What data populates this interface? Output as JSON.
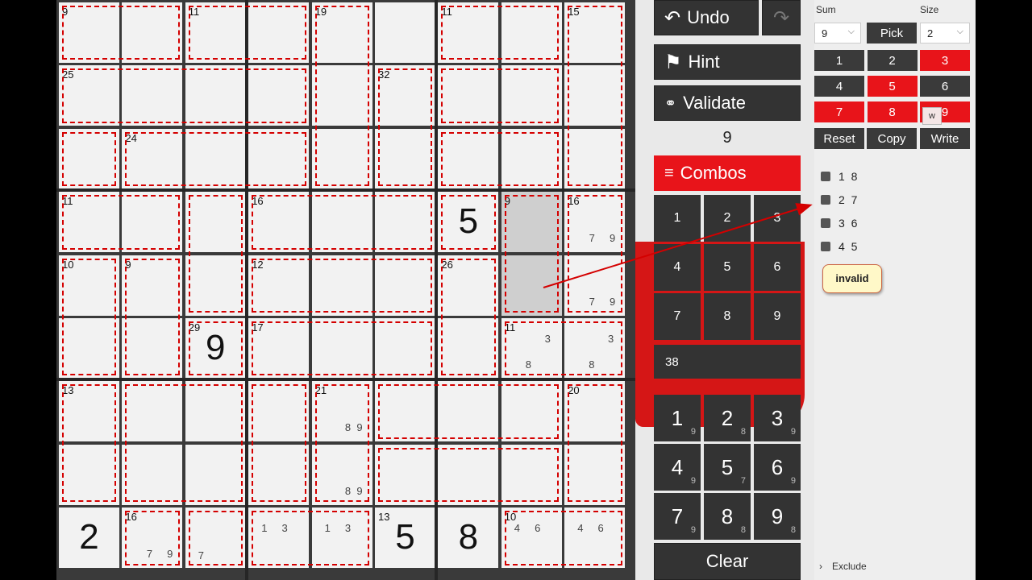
{
  "board": {
    "cages": [
      {
        "r": 0,
        "c": 0,
        "v": "9"
      },
      {
        "r": 0,
        "c": 2,
        "v": "11"
      },
      {
        "r": 0,
        "c": 4,
        "v": "19"
      },
      {
        "r": 0,
        "c": 6,
        "v": "11"
      },
      {
        "r": 0,
        "c": 8,
        "v": "15"
      },
      {
        "r": 1,
        "c": 0,
        "v": "25"
      },
      {
        "r": 1,
        "c": 5,
        "v": "32"
      },
      {
        "r": 2,
        "c": 1,
        "v": "24"
      },
      {
        "r": 3,
        "c": 0,
        "v": "11"
      },
      {
        "r": 3,
        "c": 3,
        "v": "16"
      },
      {
        "r": 3,
        "c": 7,
        "v": "9"
      },
      {
        "r": 3,
        "c": 8,
        "v": "16"
      },
      {
        "r": 4,
        "c": 0,
        "v": "10"
      },
      {
        "r": 4,
        "c": 1,
        "v": "9"
      },
      {
        "r": 4,
        "c": 3,
        "v": "12"
      },
      {
        "r": 4,
        "c": 6,
        "v": "26"
      },
      {
        "r": 5,
        "c": 2,
        "v": "29"
      },
      {
        "r": 5,
        "c": 3,
        "v": "17"
      },
      {
        "r": 5,
        "c": 7,
        "v": "11"
      },
      {
        "r": 6,
        "c": 0,
        "v": "13"
      },
      {
        "r": 6,
        "c": 4,
        "v": "21"
      },
      {
        "r": 6,
        "c": 8,
        "v": "20"
      },
      {
        "r": 8,
        "c": 1,
        "v": "16"
      },
      {
        "r": 8,
        "c": 5,
        "v": "13"
      },
      {
        "r": 8,
        "c": 7,
        "v": "10"
      }
    ],
    "values": [
      {
        "r": 3,
        "c": 6,
        "v": "5"
      },
      {
        "r": 5,
        "c": 2,
        "v": "9"
      },
      {
        "r": 8,
        "c": 0,
        "v": "2"
      },
      {
        "r": 8,
        "c": 5,
        "v": "5"
      },
      {
        "r": 8,
        "c": 6,
        "v": "8"
      }
    ],
    "candidates": [
      {
        "r": 3,
        "c": 8,
        "t": "7     9"
      },
      {
        "r": 4,
        "c": 8,
        "t": "7     9"
      },
      {
        "r": 5,
        "c": 7,
        "t": "3",
        "pos": "tr"
      },
      {
        "r": 5,
        "c": 7,
        "t": "8",
        "pos": "bc"
      },
      {
        "r": 5,
        "c": 8,
        "t": "3",
        "pos": "tr"
      },
      {
        "r": 5,
        "c": 8,
        "t": "8",
        "pos": "bc"
      },
      {
        "r": 6,
        "c": 4,
        "t": "8  9"
      },
      {
        "r": 7,
        "c": 4,
        "t": "8  9"
      },
      {
        "r": 8,
        "c": 1,
        "t": "7     9"
      },
      {
        "r": 8,
        "c": 2,
        "t": "7",
        "pos": "bl"
      },
      {
        "r": 8,
        "c": 3,
        "t": "1     3",
        "pos": "mid"
      },
      {
        "r": 8,
        "c": 4,
        "t": "1     3",
        "pos": "mid"
      },
      {
        "r": 8,
        "c": 7,
        "t": "4     6",
        "pos": "mid"
      },
      {
        "r": 8,
        "c": 8,
        "t": "4     6",
        "pos": "mid"
      }
    ]
  },
  "controls": {
    "undo_label": "Undo",
    "redo_icon": "redo-icon",
    "hint_label": "Hint",
    "validate_label": "Validate",
    "current_sum": "9",
    "combos_label": "Combos",
    "combo_keys": [
      "1",
      "2",
      "3",
      "4",
      "5",
      "6",
      "7",
      "8",
      "9"
    ],
    "combo_total": "38",
    "digits": [
      {
        "d": "1",
        "s": "9"
      },
      {
        "d": "2",
        "s": "8"
      },
      {
        "d": "3",
        "s": "9"
      },
      {
        "d": "4",
        "s": "9"
      },
      {
        "d": "5",
        "s": "7"
      },
      {
        "d": "6",
        "s": "9"
      },
      {
        "d": "7",
        "s": "9"
      },
      {
        "d": "8",
        "s": "8"
      },
      {
        "d": "9",
        "s": "8"
      }
    ],
    "clear_label": "Clear"
  },
  "side": {
    "sum_label": "Sum",
    "size_label": "Size",
    "sum_value": "9",
    "size_value": "2",
    "pick_label": "Pick",
    "numbers": [
      {
        "n": "1",
        "on": false
      },
      {
        "n": "2",
        "on": false
      },
      {
        "n": "3",
        "on": true
      },
      {
        "n": "4",
        "on": false
      },
      {
        "n": "5",
        "on": true
      },
      {
        "n": "6",
        "on": false
      },
      {
        "n": "7",
        "on": true
      },
      {
        "n": "8",
        "on": true
      },
      {
        "n": "9",
        "on": true
      }
    ],
    "tooltip_w": "w",
    "reset_label": "Reset",
    "copy_label": "Copy",
    "write_label": "Write",
    "combos": [
      "1  8",
      "2  7",
      "3  6",
      "4  5"
    ],
    "invalid_label": "invalid",
    "exclude_label": "Exclude"
  },
  "colors": {
    "accent": "#e8141a",
    "dark_button": "#333333",
    "panel": "#e9e9e9"
  }
}
